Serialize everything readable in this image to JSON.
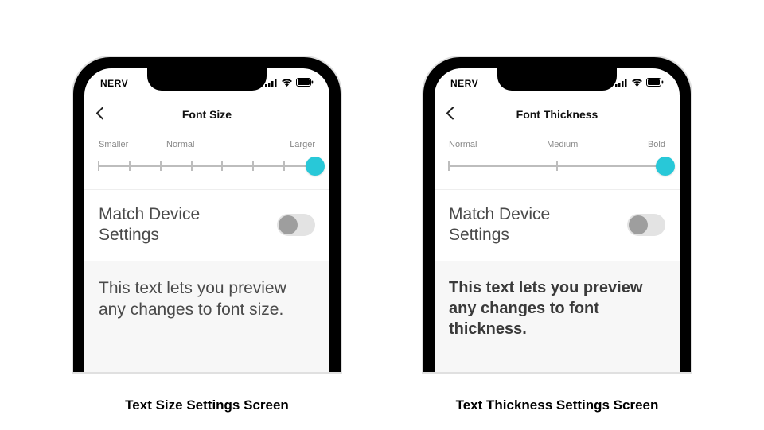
{
  "status": {
    "carrier": "NERV",
    "signal_bars": 4,
    "wifi_bars": 3,
    "battery_level": "full"
  },
  "screens": [
    {
      "caption": "Text Size Settings Screen",
      "nav_title": "Font Size",
      "slider": {
        "label_left": "Smaller",
        "label_mid": "Normal",
        "label_right": "Larger",
        "ticks": 8,
        "value_index": 7
      },
      "toggle": {
        "label": "Match Device Settings",
        "on": false
      },
      "preview": "This text lets you preview any changes to font size.",
      "preview_style": "size"
    },
    {
      "caption": "Text Thickness Settings Screen",
      "nav_title": "Font Thickness",
      "slider": {
        "label_left": "Normal",
        "label_mid": "Medium",
        "label_right": "Bold",
        "ticks": 3,
        "value_index": 2
      },
      "toggle": {
        "label": "Match Device Settings",
        "on": false
      },
      "preview": "This text lets you preview any changes to font thickness.",
      "preview_style": "bold"
    }
  ]
}
